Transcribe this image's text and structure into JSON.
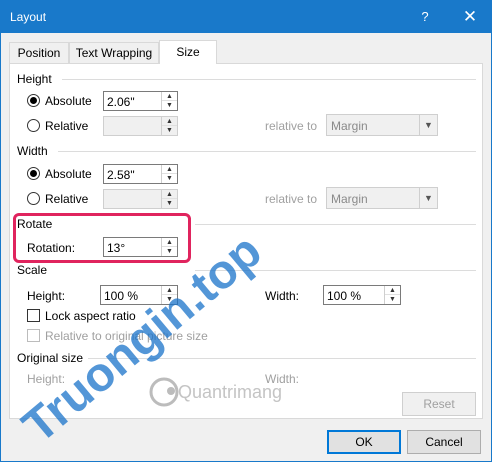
{
  "window": {
    "title": "Layout",
    "help_label": "?",
    "close_label": "✕"
  },
  "tabs": [
    {
      "label": "Position"
    },
    {
      "label": "Text Wrapping"
    },
    {
      "label": "Size"
    }
  ],
  "height": {
    "group_label": "Height",
    "absolute_label": "Absolute",
    "absolute_value": "2.06\"",
    "relative_label": "Relative",
    "relative_to_label": "relative to",
    "relative_to_value": "Margin"
  },
  "width": {
    "group_label": "Width",
    "absolute_label": "Absolute",
    "absolute_value": "2.58\"",
    "relative_label": "Relative",
    "relative_to_label": "relative to",
    "relative_to_value": "Margin"
  },
  "rotate": {
    "group_label": "Rotate",
    "rotation_label": "Rotation:",
    "rotation_value": "13°"
  },
  "scale": {
    "group_label": "Scale",
    "height_label": "Height:",
    "height_value": "100 %",
    "width_label": "Width:",
    "width_value": "100 %",
    "lock_label": "Lock aspect ratio",
    "relative_label": "Relative to original picture size"
  },
  "original_size": {
    "group_label": "Original size",
    "height_label": "Height:",
    "width_label": "Width:",
    "reset_label": "Reset"
  },
  "buttons": {
    "ok_label": "OK",
    "cancel_label": "Cancel"
  },
  "watermark": {
    "brand_text": "Truongin.top",
    "site_text": "Quantrimang"
  },
  "colors": {
    "titlebar": "#1979ca",
    "highlight": "#e0245e",
    "default_button_border": "#0078d7"
  }
}
